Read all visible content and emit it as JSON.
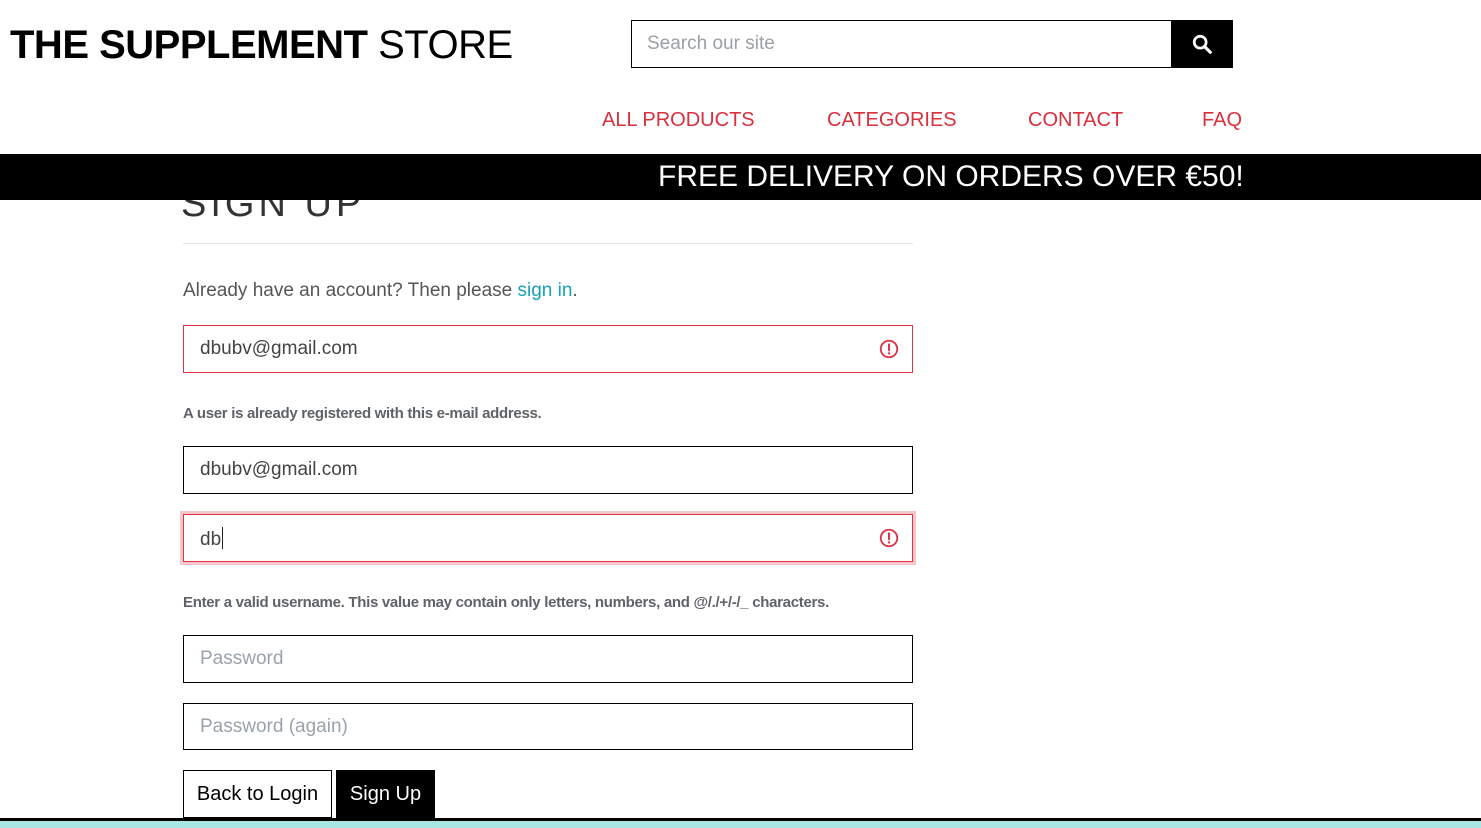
{
  "header": {
    "logo_bold": "THE SUPPLEMENT",
    "logo_light": "STORE",
    "search_placeholder": "Search our site"
  },
  "nav": {
    "items": [
      "ALL PRODUCTS",
      "CATEGORIES",
      "CONTACT",
      "FAQ"
    ]
  },
  "banner": {
    "text": "FREE DELIVERY ON ORDERS OVER €50!"
  },
  "page": {
    "title": "SIGN UP",
    "already_text": "Already have an account? Then please ",
    "already_link": "sign in",
    "already_end": "."
  },
  "form": {
    "email": "dbubv@gmail.com",
    "email_error": "A user is already registered with this e-mail address.",
    "email_confirm": "dbubv@gmail.com",
    "username": "db",
    "username_error": "Enter a valid username. This value may contain only letters, numbers, and @/./+/-/_ characters.",
    "password_placeholder": "Password",
    "password2_placeholder": "Password (again)",
    "back_label": "Back to Login",
    "signup_label": "Sign Up"
  },
  "colors": {
    "nav_red": "#d9303e",
    "link_teal": "#17a2b8",
    "error_red": "#dc3545",
    "footer_teal": "#a8e6e3"
  },
  "icons": {
    "search": "search-icon",
    "invalid": "alert-circle-icon"
  }
}
